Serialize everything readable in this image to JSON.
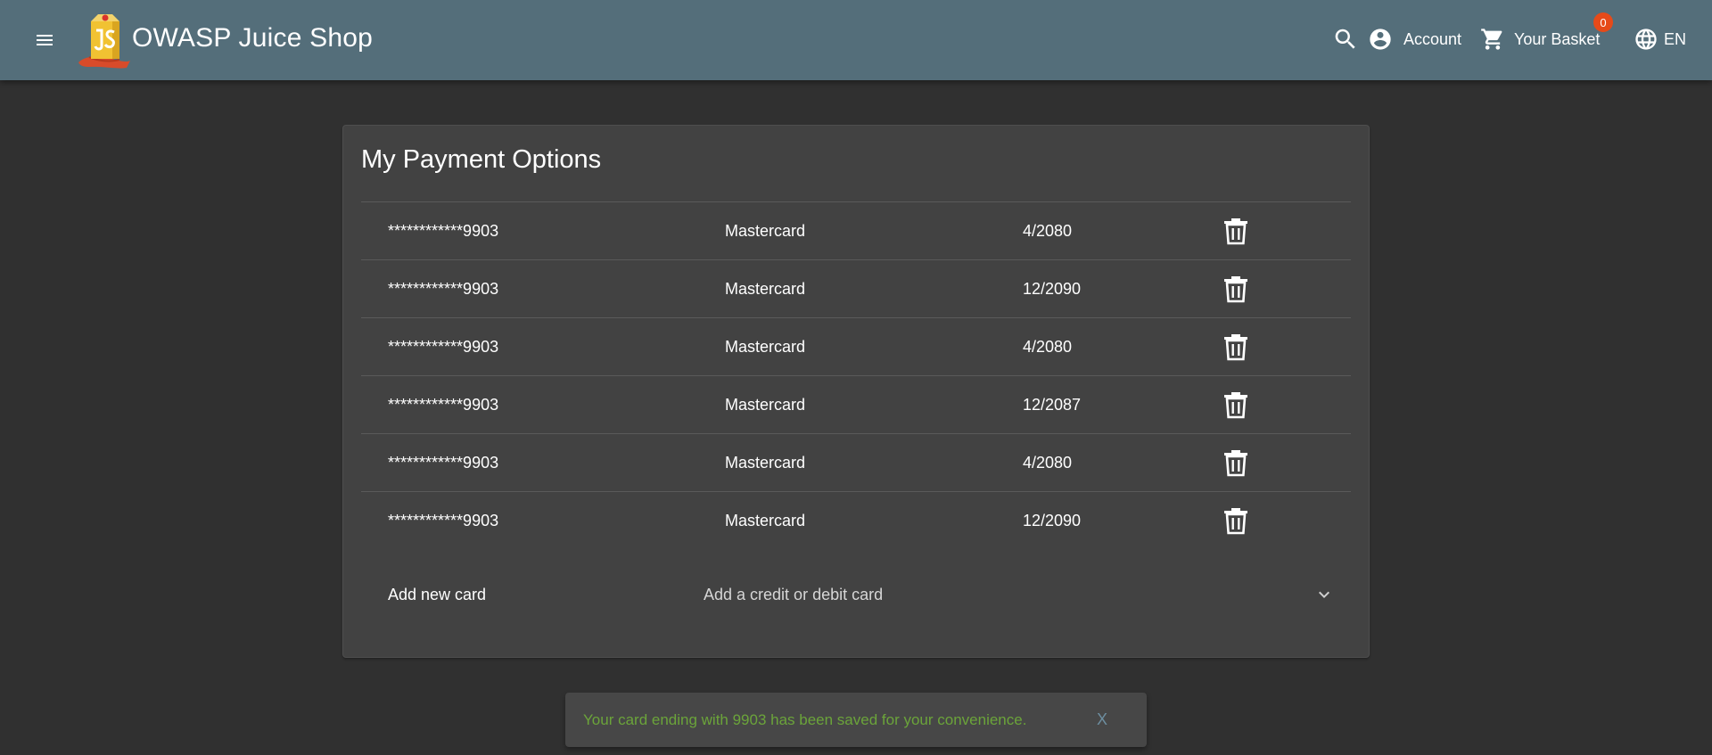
{
  "header": {
    "title": "OWASP Juice Shop",
    "menu_icon": "menu-icon",
    "search_icon": "search-icon",
    "account_label": "Account",
    "basket_label": "Your Basket",
    "basket_count": "0",
    "language_label": "EN",
    "background_color": "#546e7a",
    "badge_color": "#e64a19"
  },
  "page": {
    "title": "My Payment Options"
  },
  "cards": [
    {
      "number": "************9903",
      "brand": "Mastercard",
      "expiry": "4/2080"
    },
    {
      "number": "************9903",
      "brand": "Mastercard",
      "expiry": "12/2090"
    },
    {
      "number": "************9903",
      "brand": "Mastercard",
      "expiry": "4/2080"
    },
    {
      "number": "************9903",
      "brand": "Mastercard",
      "expiry": "12/2087"
    },
    {
      "number": "************9903",
      "brand": "Mastercard",
      "expiry": "4/2080"
    },
    {
      "number": "************9903",
      "brand": "Mastercard",
      "expiry": "12/2090"
    }
  ],
  "add_card": {
    "title": "Add new card",
    "description": "Add a credit or debit card"
  },
  "snackbar": {
    "message": "Your card ending with 9903 has been saved for your convenience.",
    "close_label": "X",
    "message_color": "#6ba43a"
  }
}
